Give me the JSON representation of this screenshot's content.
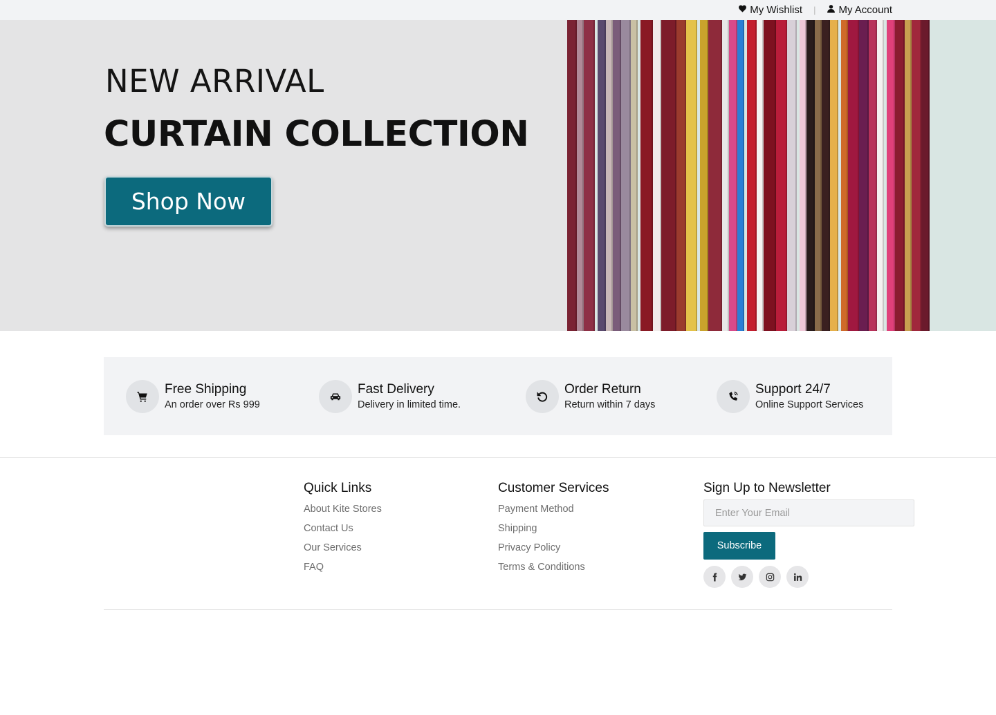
{
  "topbar": {
    "wishlist_label": "My Wishlist",
    "separator": "|",
    "account_label": "My Account"
  },
  "hero": {
    "kicker": "NEW ARRIVAL",
    "title": "CURTAIN COLLECTION",
    "button_label": "Shop Now",
    "image_icon": "curtains-photo",
    "accent_color": "#0c6a7d"
  },
  "features": [
    {
      "icon": "cart-icon",
      "title": "Free Shipping",
      "desc": "An order over Rs 999"
    },
    {
      "icon": "car-icon",
      "title": "Fast Delivery",
      "desc": "Delivery in limited time."
    },
    {
      "icon": "undo-icon",
      "title": "Order Return",
      "desc": "Return within 7 days"
    },
    {
      "icon": "phone-icon",
      "title": "Support 24/7",
      "desc": "Online Support Services"
    }
  ],
  "footer": {
    "quick_links": {
      "title": "Quick Links",
      "items": [
        "About Kite Stores",
        "Contact Us",
        "Our Services",
        "FAQ"
      ]
    },
    "customer_services": {
      "title": "Customer Services",
      "items": [
        "Payment Method",
        "Shipping",
        "Privacy Policy",
        "Terms & Conditions"
      ]
    },
    "newsletter": {
      "title": "Sign Up to Newsletter",
      "email_placeholder": "Enter Your Email",
      "email_value": "",
      "subscribe_label": "Subscribe",
      "socials": [
        "facebook-icon",
        "twitter-icon",
        "instagram-icon",
        "linkedin-icon"
      ]
    }
  }
}
